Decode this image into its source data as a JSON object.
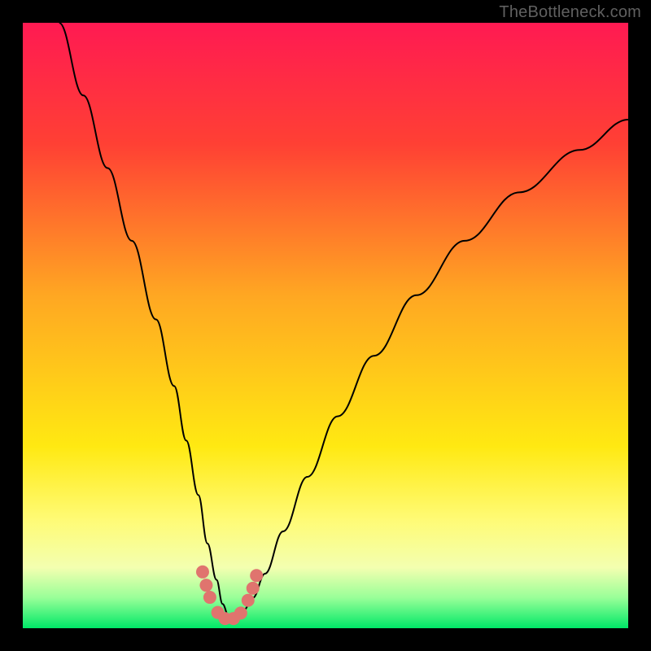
{
  "watermark": "TheBottleneck.com",
  "chart_data": {
    "type": "line",
    "title": "",
    "xlabel": "",
    "ylabel": "",
    "xlim": [
      0,
      100
    ],
    "ylim": [
      0,
      100
    ],
    "grid": false,
    "legend": false,
    "background_gradient": {
      "stops": [
        {
          "offset": 0.0,
          "color": "#ff1a52"
        },
        {
          "offset": 0.2,
          "color": "#ff4034"
        },
        {
          "offset": 0.45,
          "color": "#ffa722"
        },
        {
          "offset": 0.7,
          "color": "#ffe912"
        },
        {
          "offset": 0.82,
          "color": "#fffb75"
        },
        {
          "offset": 0.9,
          "color": "#f3ffb0"
        },
        {
          "offset": 0.95,
          "color": "#98ff98"
        },
        {
          "offset": 1.0,
          "color": "#00e867"
        }
      ]
    },
    "series": [
      {
        "name": "bottleneck-curve",
        "color": "#000000",
        "stroke_width": 2,
        "x": [
          6,
          10,
          14,
          18,
          22,
          25,
          27,
          29,
          30.5,
          32,
          33,
          34,
          35,
          36.5,
          38,
          40,
          43,
          47,
          52,
          58,
          65,
          73,
          82,
          92,
          100
        ],
        "values": [
          100,
          88,
          76,
          64,
          51,
          40,
          31,
          22,
          14,
          8,
          4,
          2,
          2,
          3,
          5,
          9,
          16,
          25,
          35,
          45,
          55,
          64,
          72,
          79,
          84
        ]
      }
    ],
    "markers": {
      "name": "optimal-range-dots",
      "color": "#e0746e",
      "radius": 8,
      "x": [
        29.7,
        30.3,
        30.9,
        32.2,
        33.4,
        34.8,
        36.0,
        37.2,
        38.0,
        38.6
      ],
      "values": [
        9.3,
        7.1,
        5.1,
        2.6,
        1.6,
        1.6,
        2.5,
        4.6,
        6.6,
        8.7
      ]
    }
  }
}
